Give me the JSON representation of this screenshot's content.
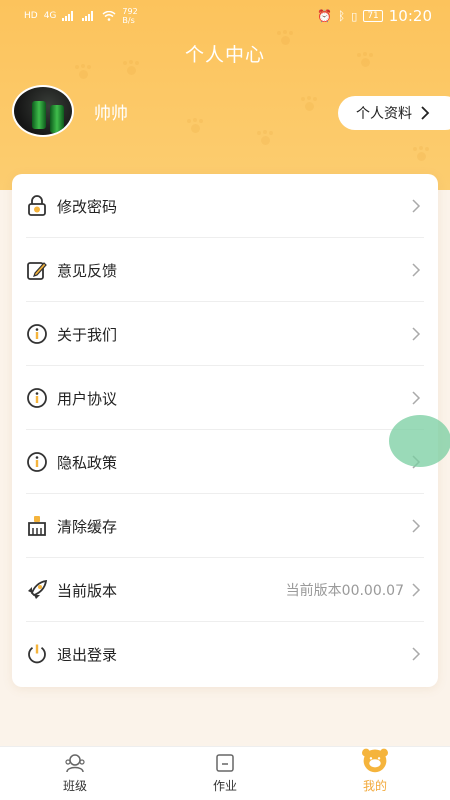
{
  "status_bar": {
    "net_speed": "792\nB/s",
    "sim_labels": [
      "HD",
      "4G"
    ],
    "battery": "71",
    "time": "10:20"
  },
  "header": {
    "title": "个人中心",
    "username": "帅帅",
    "profile_button": "个人资料"
  },
  "menu": [
    {
      "label": "修改密码",
      "value": "",
      "icon": "lock-icon"
    },
    {
      "label": "意见反馈",
      "value": "",
      "icon": "edit-icon"
    },
    {
      "label": "关于我们",
      "value": "",
      "icon": "info-icon"
    },
    {
      "label": "用户协议",
      "value": "",
      "icon": "info-icon"
    },
    {
      "label": "隐私政策",
      "value": "",
      "icon": "info-icon"
    },
    {
      "label": "清除缓存",
      "value": "",
      "icon": "broom-icon"
    },
    {
      "label": "当前版本",
      "value": "当前版本00.00.07",
      "icon": "rocket-icon"
    },
    {
      "label": "退出登录",
      "value": "",
      "icon": "power-icon"
    }
  ],
  "tabbar": {
    "tabs": [
      {
        "label": "班级",
        "icon": "class-icon",
        "active": false
      },
      {
        "label": "作业",
        "icon": "homework-icon",
        "active": false
      },
      {
        "label": "我的",
        "icon": "bear-icon",
        "active": true
      }
    ]
  },
  "colors": {
    "header_bg": "#fcc35c",
    "accent": "#f2a93b",
    "icon_yellow": "#f5b43c"
  }
}
